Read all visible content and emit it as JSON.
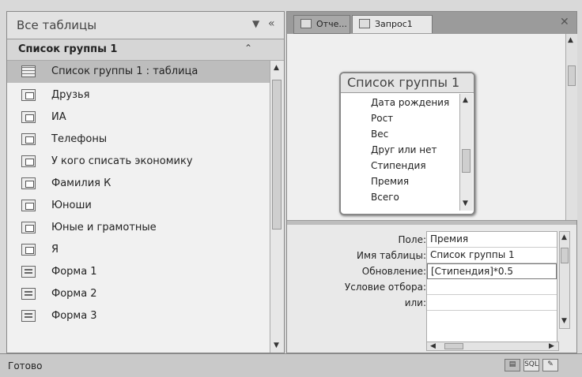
{
  "nav": {
    "title": "Все таблицы",
    "group_label": "Список группы 1",
    "items": [
      {
        "label": "Список группы 1 : таблица",
        "icon": "table-icon"
      },
      {
        "label": "Друзья",
        "icon": "query-icon"
      },
      {
        "label": "ИА",
        "icon": "query-icon"
      },
      {
        "label": "Телефоны",
        "icon": "query-icon"
      },
      {
        "label": "У кого списать экономику",
        "icon": "query-icon"
      },
      {
        "label": "Фамилия К",
        "icon": "query-icon"
      },
      {
        "label": "Юноши",
        "icon": "query-icon"
      },
      {
        "label": "Юные и грамотные",
        "icon": "query-icon"
      },
      {
        "label": "Я",
        "icon": "query-icon"
      },
      {
        "label": "Форма 1",
        "icon": "form-icon"
      },
      {
        "label": "Форма 2",
        "icon": "form-icon"
      },
      {
        "label": "Форма 3",
        "icon": "form-icon"
      }
    ]
  },
  "tabs": [
    {
      "label": "Отче..."
    },
    {
      "label": "Запрос1"
    }
  ],
  "field_list": {
    "title": "Список группы 1",
    "fields": [
      "Дата рождения",
      "Рост",
      "Вес",
      "Друг или нет",
      "Стипендия",
      "Премия",
      "Всего"
    ]
  },
  "grid": {
    "labels": {
      "field": "Поле:",
      "table": "Имя таблицы:",
      "update": "Обновление:",
      "criteria": "Условие отбора:",
      "or": "или:"
    },
    "values": {
      "field": "Премия",
      "table": "Список группы 1",
      "update": "[Стипендия]*0.5"
    }
  },
  "status": {
    "text": "Готово",
    "sql_label": "SQL"
  }
}
